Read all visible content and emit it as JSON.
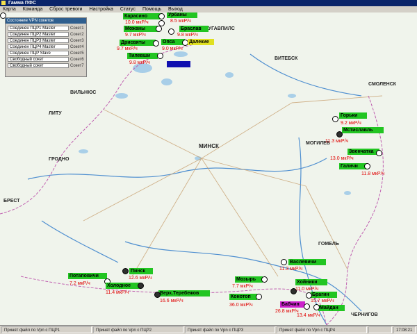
{
  "window": {
    "title": "Гамма ПФС"
  },
  "menu": [
    "Карта",
    "Команда",
    "Сброс тревоги",
    "Настройка",
    "Статус",
    "Помощь",
    "Выход"
  ],
  "panel": {
    "title": "Состояние VPN сокетов",
    "rows": [
      {
        "label": "Соединен ПЦР1 Master",
        "socket": "Сокет1"
      },
      {
        "label": "Соединен ПЦР2 Master",
        "socket": "Сокет2"
      },
      {
        "label": "Соединен ПЦР3 Master",
        "socket": "Сокет3"
      },
      {
        "label": "Соединен ПЦР4 Master",
        "socket": "Сокет4"
      },
      {
        "label": "Соединен ПЦР Slave",
        "socket": "Сокет5"
      },
      {
        "label": "Свободный сокет",
        "socket": "Сокет6"
      },
      {
        "label": "Свободный сокет",
        "socket": "Сокет7"
      }
    ]
  },
  "cities": [
    "ВИЛЬНЮС",
    "МИНСК",
    "ВИТЕБСК",
    "СМОЛЕНСК",
    "ГРОДНО",
    "БРЕСТ",
    "МОГИЛЕВ",
    "ГОМЕЛЬ",
    "ЧЕРНИГОВ",
    "ДАУГАВПИЛС",
    "ЛИТУ"
  ],
  "stations": [
    {
      "name": "Карасино",
      "value": "10.0 мкР/ч",
      "color": "#22c522",
      "marker": "white"
    },
    {
      "name": "Урбаны",
      "value": "8.5 мкР/ч",
      "color": "#22c522",
      "marker": "white"
    },
    {
      "name": "Можаны",
      "value": "9.7 мкР/ч",
      "color": "#22c522",
      "marker": "white"
    },
    {
      "name": "Браслав",
      "value": "9.8 мкР/ч",
      "color": "#22c522",
      "marker": "white"
    },
    {
      "name": "Дрисвяты",
      "value": "9.7 мкР/ч",
      "color": "#22c522",
      "marker": "white"
    },
    {
      "name": "Опса",
      "value": "9.0 мкР/ч",
      "color": "#22c522",
      "marker": "white"
    },
    {
      "name": "Далекие",
      "value": "",
      "color": "#e0e020",
      "marker": "white"
    },
    {
      "name": "Тилевши",
      "value": "9.8 мкР/ч",
      "color": "#22c522",
      "marker": "white"
    },
    {
      "name": "",
      "value": "",
      "color": "#1010b0",
      "marker": "none"
    },
    {
      "name": "Горьки",
      "value": "9.2 мкР/ч",
      "color": "#22c522",
      "marker": "white"
    },
    {
      "name": "Мстиславль",
      "value": "11.3 мкР/ч",
      "color": "#22c522",
      "marker": "dark"
    },
    {
      "name": "Звенчатка",
      "value": "13.0 мкР/ч",
      "color": "#22c522",
      "marker": "white"
    },
    {
      "name": "Галичи",
      "value": "11.8 мкР/ч",
      "color": "#22c522",
      "marker": "white"
    },
    {
      "name": "Васлевичи",
      "value": "11.3 мкР/ч",
      "color": "#22c522",
      "marker": "white"
    },
    {
      "name": "Потаповичи",
      "value": "7.2 мкР/ч",
      "color": "#22c522",
      "marker": "white"
    },
    {
      "name": "Пинск",
      "value": "12.6 мкР/ч",
      "color": "#22c522",
      "marker": "dark"
    },
    {
      "name": "Холодное",
      "value": "11.4 мкР/ч",
      "color": "#22c522",
      "marker": "dark"
    },
    {
      "name": "Верх.Теребежов",
      "value": "16.6 мкР/ч",
      "color": "#22c522",
      "marker": "dark"
    },
    {
      "name": "Мозырь",
      "value": "7.7 мкР/ч",
      "color": "#22c522",
      "marker": "white"
    },
    {
      "name": "Хойники",
      "value": "11.0 мкР/ч",
      "color": "#22c522",
      "marker": "dark"
    },
    {
      "name": "Конотоп",
      "value": "36.0 мкР/ч",
      "color": "#22c522",
      "marker": "white"
    },
    {
      "name": "Брагин",
      "value": "15.7 мкР/ч",
      "color": "#22c522",
      "marker": "white"
    },
    {
      "name": "Бабчин",
      "value": "26.8 мкР/ч",
      "color": "#cc22cc",
      "marker": "white"
    },
    {
      "name": "Майдан",
      "value": "13.4 мкР/ч",
      "color": "#22c522",
      "marker": "white"
    }
  ],
  "status": {
    "cells": [
      "Принят файл по Vpn с ПЦР1",
      "Принят файл по Vpn с ПЦР2",
      "Принят файл по Vpn с ПЦР3",
      "Принят файл по Vpn с ПЦР4"
    ],
    "time": "17:08:21"
  }
}
